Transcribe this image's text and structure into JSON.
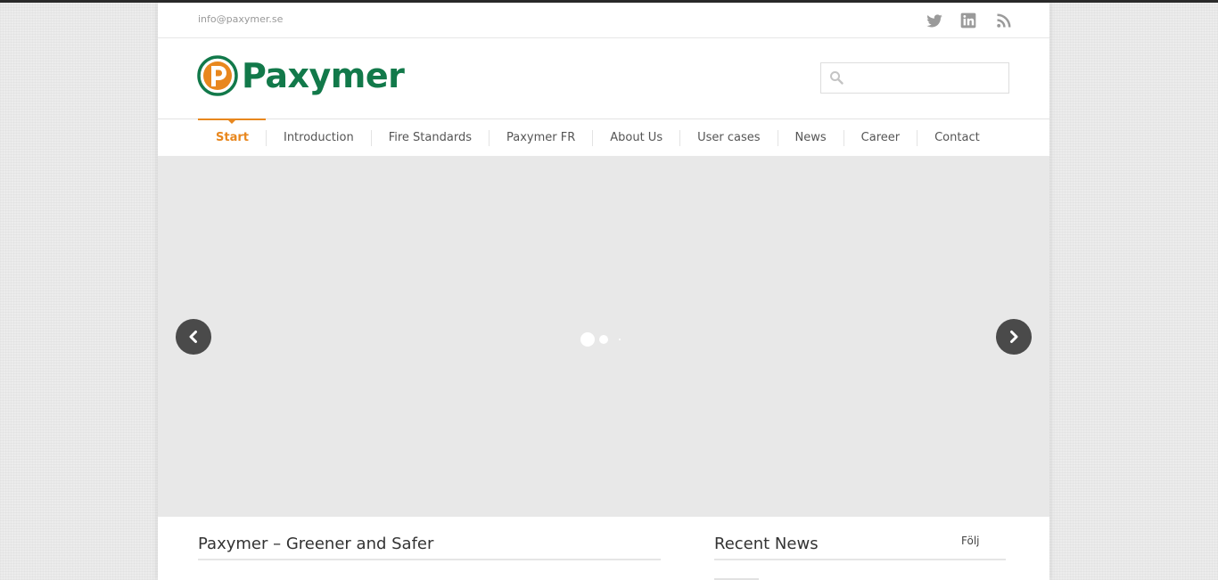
{
  "topbar": {
    "email": "info@paxymer.se",
    "social": [
      {
        "icon": "twitter-icon"
      },
      {
        "icon": "linkedin-icon"
      },
      {
        "icon": "rss-icon"
      }
    ]
  },
  "header": {
    "logo_text": "Paxymer",
    "search": {
      "placeholder": "",
      "value": ""
    }
  },
  "nav": {
    "items": [
      {
        "label": "Start",
        "active": true
      },
      {
        "label": "Introduction"
      },
      {
        "label": "Fire Standards"
      },
      {
        "label": "Paxymer FR"
      },
      {
        "label": "About Us"
      },
      {
        "label": "User cases"
      },
      {
        "label": "News"
      },
      {
        "label": "Career"
      },
      {
        "label": "Contact"
      }
    ]
  },
  "main": {
    "title": "Paxymer – Greener and Safer"
  },
  "sidebar": {
    "title": "Recent News",
    "follow_label": "Följ"
  },
  "colors": {
    "accent": "#e8871e",
    "brand_green": "#12794a",
    "slider_bg": "#e8e8e8",
    "arrow_bg": "#4a4a4a"
  }
}
